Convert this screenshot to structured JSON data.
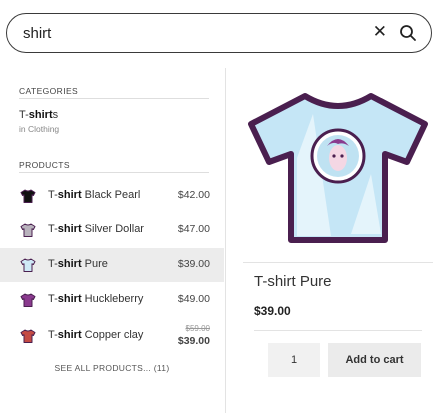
{
  "search": {
    "value": "shirt",
    "clear_icon": "close-icon",
    "search_icon": "search-icon"
  },
  "categories": {
    "heading": "CATEGORIES",
    "items": [
      {
        "title_bold_prefix": "T-",
        "title_bold": "shirt",
        "title_suffix": "s",
        "subtitle": "in Clothing"
      }
    ]
  },
  "products": {
    "heading": "PRODUCTS",
    "items": [
      {
        "name_prefix": "T-",
        "name_bold": "shirt",
        "name_suffix": " Black Pearl",
        "price": "$42.00",
        "color": "#111111",
        "icon": "tshirt-icon"
      },
      {
        "name_prefix": "T-",
        "name_bold": "shirt",
        "name_suffix": " Silver Dollar",
        "price": "$47.00",
        "color": "#b9b3bd",
        "icon": "tshirt-icon"
      },
      {
        "name_prefix": "T-",
        "name_bold": "shirt",
        "name_suffix": " Pure",
        "price": "$39.00",
        "color": "#cfe9f7",
        "icon": "tshirt-icon",
        "active": true
      },
      {
        "name_prefix": "T-",
        "name_bold": "shirt",
        "name_suffix": " Huckleberry",
        "price": "$49.00",
        "color": "#8a3a8e",
        "icon": "tshirt-icon"
      },
      {
        "name_prefix": "T-",
        "name_bold": "shirt",
        "name_suffix": " Copper clay",
        "price_old": "$59.00",
        "price": "$39.00",
        "color": "#c44a44",
        "icon": "tshirt-icon"
      }
    ],
    "see_all": "SEE ALL PRODUCTS... (11)"
  },
  "preview": {
    "title": "T-shirt Pure",
    "price": "$39.00",
    "quantity": "1",
    "add_to_cart": "Add to cart",
    "image_icon": "tshirt-icon"
  },
  "colors": {
    "shirt_outline": "#4a1f4f",
    "shirt_fill": "#c5e6f6",
    "active_row": "#ececec"
  }
}
